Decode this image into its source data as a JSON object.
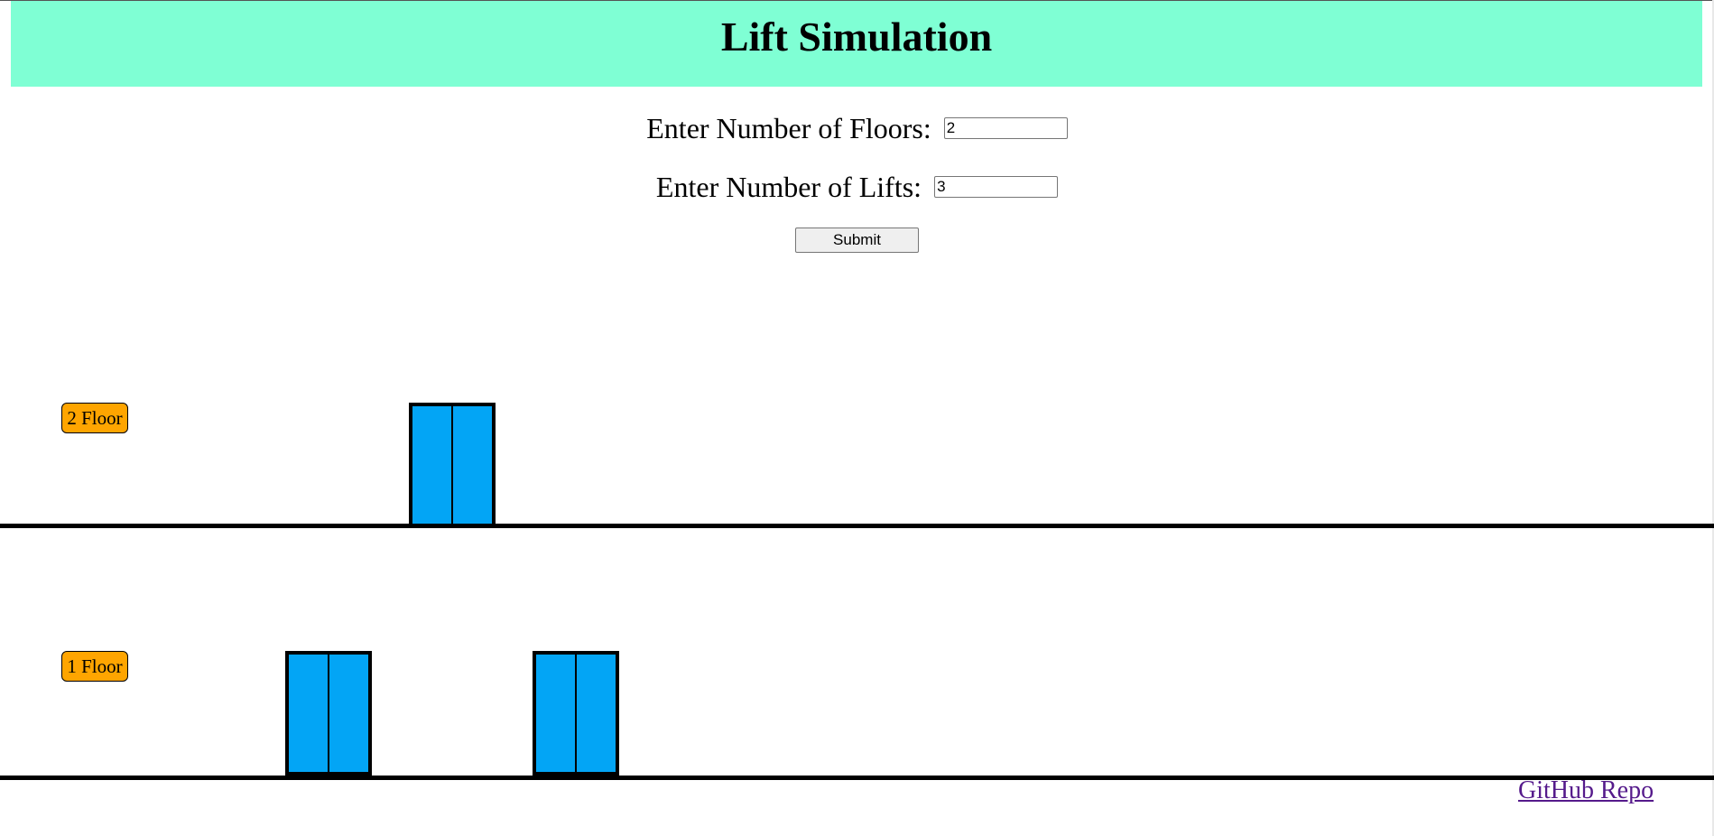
{
  "header": {
    "title": "Lift Simulation",
    "bg_color": "#7fffd4"
  },
  "form": {
    "floors_label": "Enter Number of Floors:",
    "floors_value": "2",
    "lifts_label": "Enter Number of Lifts:",
    "lifts_value": "3",
    "submit_label": "Submit"
  },
  "building": {
    "floors": [
      {
        "label": "2 Floor"
      },
      {
        "label": "1 Floor"
      }
    ],
    "lifts": [
      {
        "id": 1,
        "current_floor": 1
      },
      {
        "id": 2,
        "current_floor": 2
      },
      {
        "id": 3,
        "current_floor": 1
      }
    ],
    "colors": {
      "floor_label": "#ffa500",
      "lift_door": "#03a5f5",
      "floor_line": "#000000"
    }
  },
  "footer": {
    "github_link": "GitHub Repo",
    "link_color": "#551a8b"
  }
}
